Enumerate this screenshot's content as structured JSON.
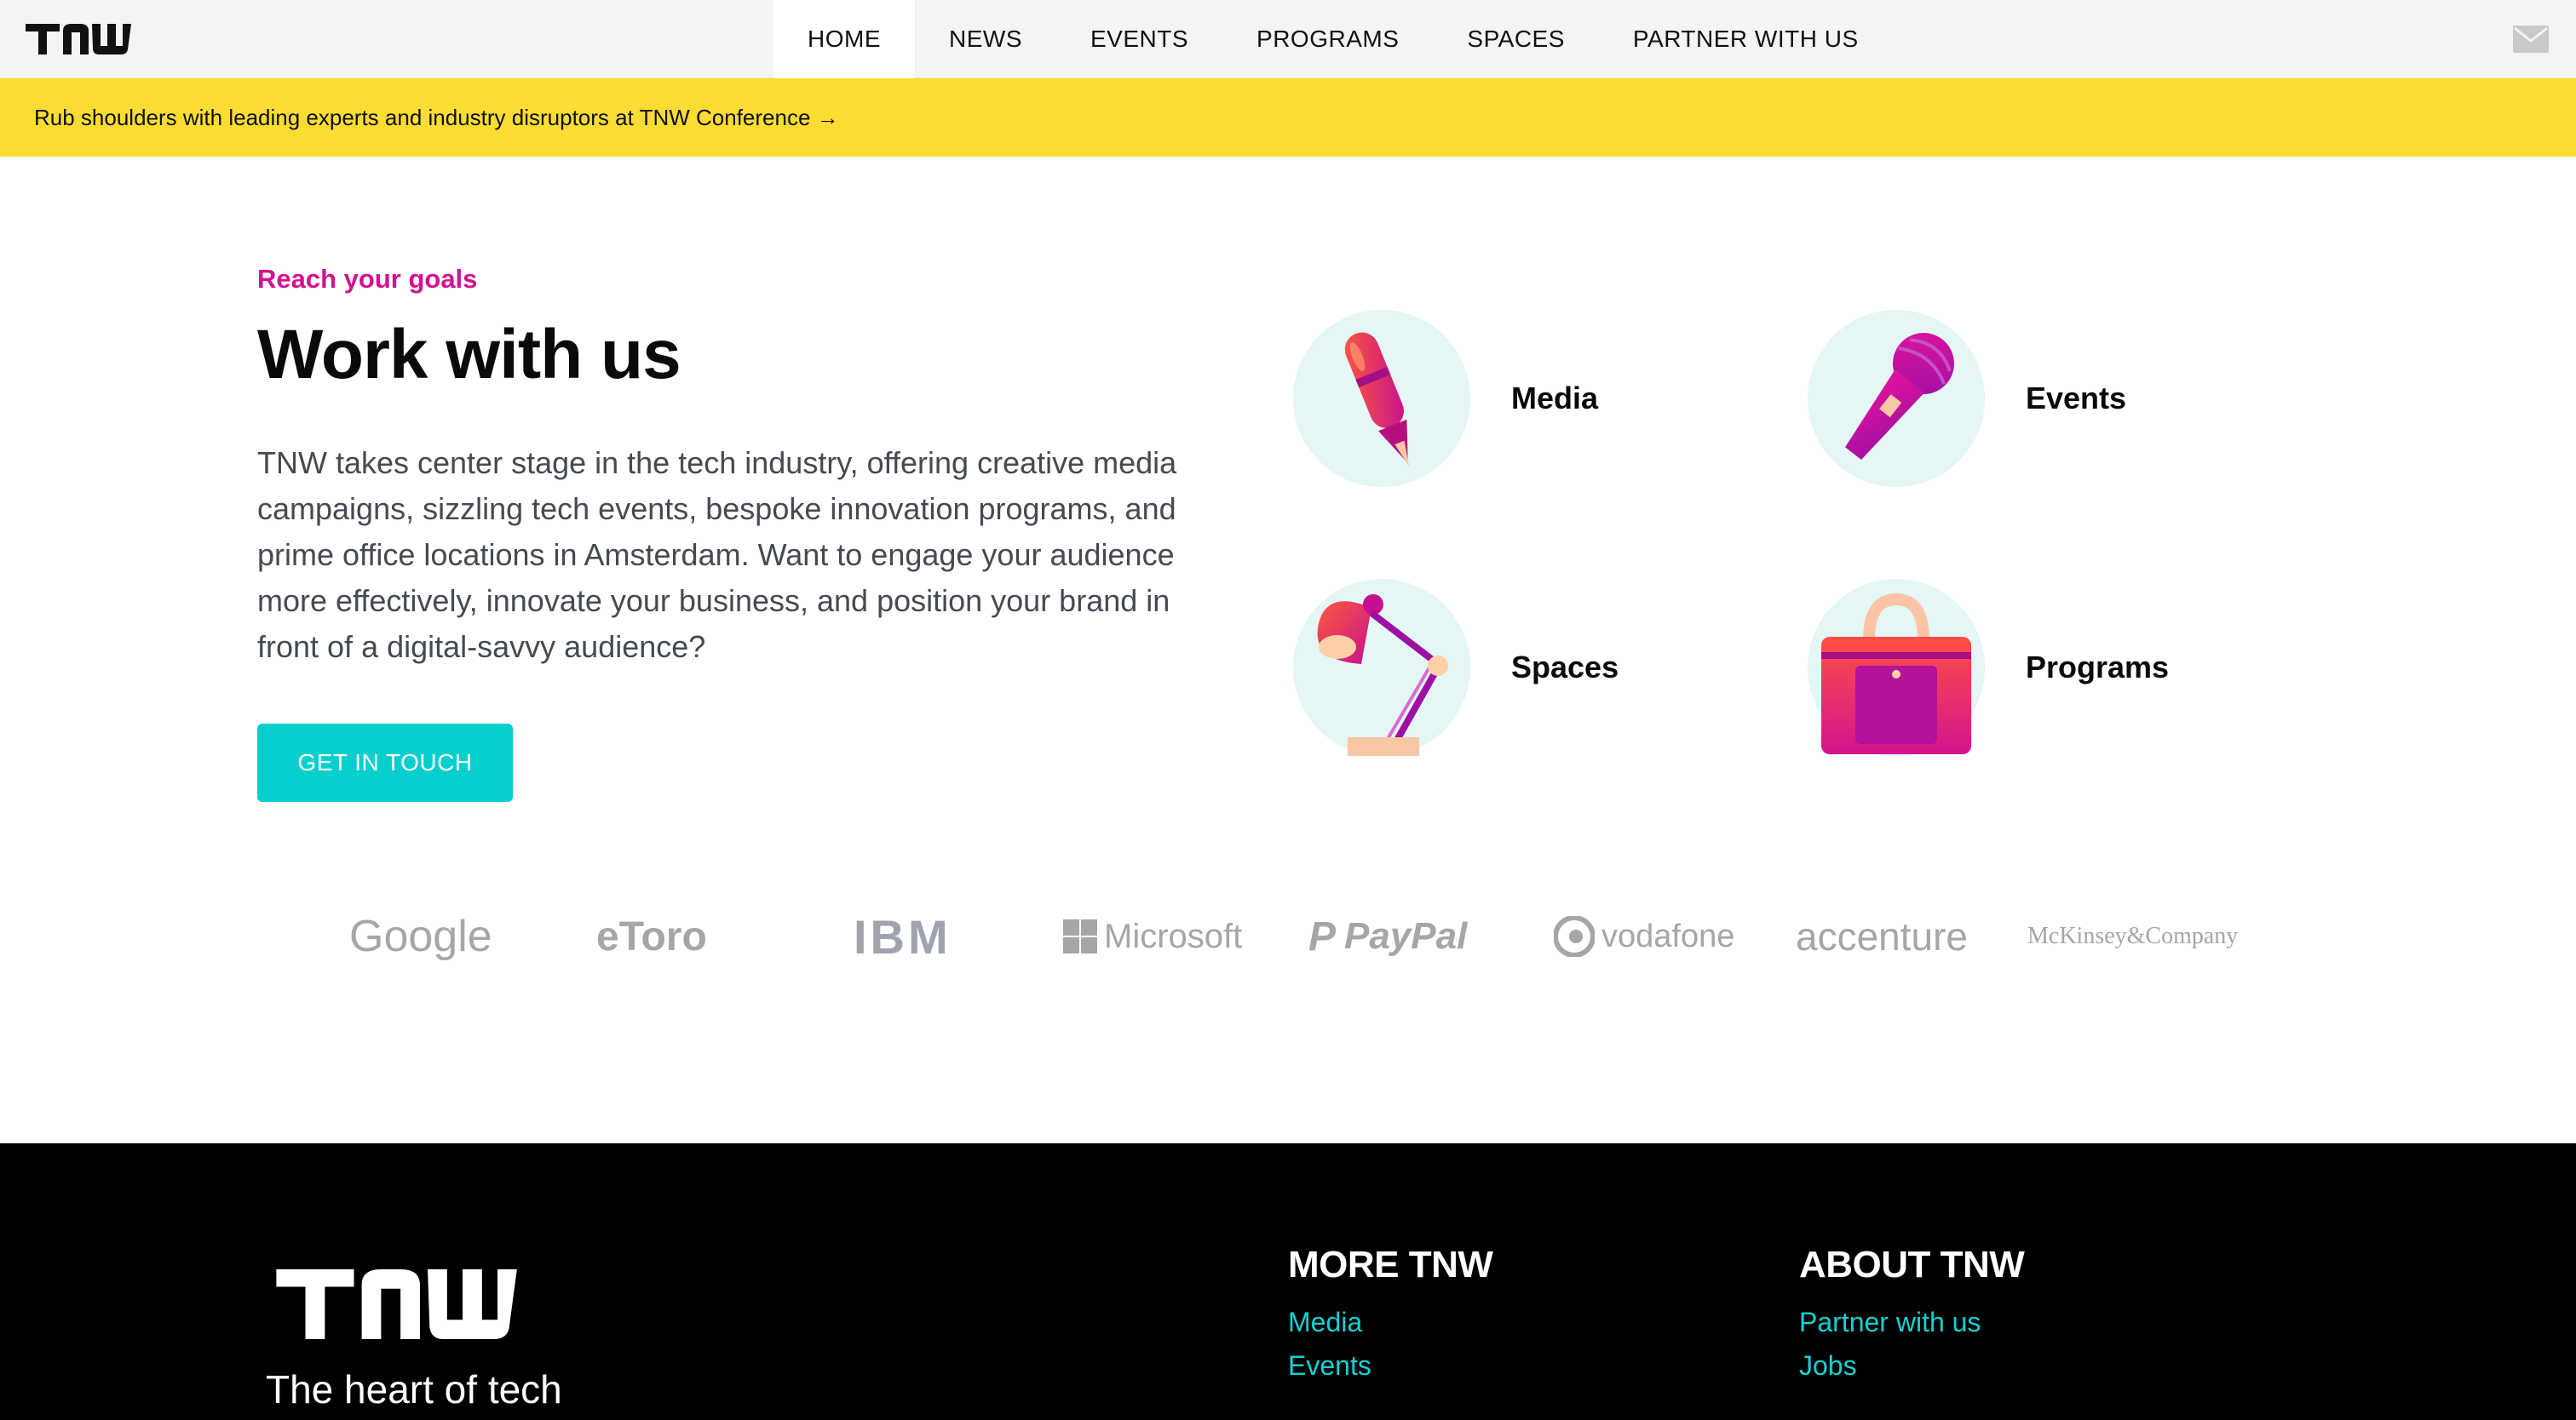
{
  "nav": {
    "logo": "TNW",
    "items": [
      {
        "label": "HOME",
        "active": true
      },
      {
        "label": "NEWS"
      },
      {
        "label": "EVENTS"
      },
      {
        "label": "PROGRAMS"
      },
      {
        "label": "SPACES"
      },
      {
        "label": "PARTNER WITH US"
      }
    ],
    "mail_icon": "mail-icon"
  },
  "banner": {
    "text": "Rub shoulders with leading experts and industry disruptors at TNW Conference →"
  },
  "hero": {
    "eyebrow": "Reach your goals",
    "title": "Work with us",
    "description": "TNW takes center stage in the tech industry, offering creative media campaigns, sizzling tech events, bespoke innovation programs, and prime office locations in Amsterdam. Want to engage your audience more effectively, innovate your business, and position your brand in front of a digital-savvy audience?",
    "cta": "GET IN TOUCH"
  },
  "services": [
    {
      "label": "Media",
      "icon": "pen-icon"
    },
    {
      "label": "Events",
      "icon": "microphone-icon"
    },
    {
      "label": "Spaces",
      "icon": "desk-lamp-icon"
    },
    {
      "label": "Programs",
      "icon": "bag-icon"
    }
  ],
  "partners": [
    "Google",
    "eToro",
    "IBM",
    "Microsoft",
    "PayPal",
    "vodafone",
    "accenture",
    "McKinsey&Company"
  ],
  "footer": {
    "logo": "TNW",
    "tagline": "The heart of tech",
    "more": {
      "heading": "MORE TNW",
      "links": [
        "Media",
        "Events"
      ]
    },
    "about": {
      "heading": "ABOUT TNW",
      "links": [
        "Partner with us",
        "Jobs"
      ]
    }
  },
  "colors": {
    "accent": "#d4118f",
    "cta": "#06cfce",
    "banner": "#fbdc33",
    "footer_link": "#11d1d4"
  }
}
